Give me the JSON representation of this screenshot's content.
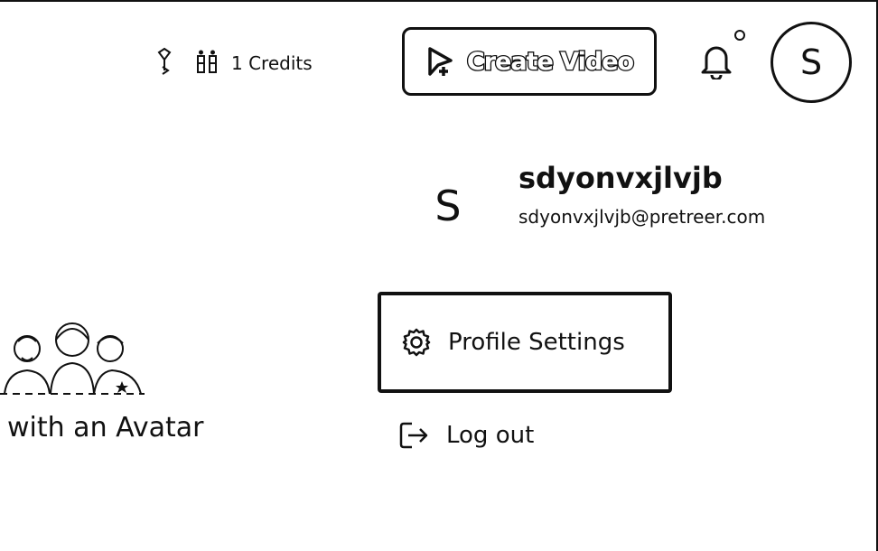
{
  "header": {
    "credits_label": "1 Credits",
    "create_video_label": "Create Video",
    "avatar_initial": "S",
    "icons": {
      "gem": "diamond-icon",
      "coins": "coin-stack-icon",
      "create": "video-plus-icon",
      "notifications": "bell-icon"
    }
  },
  "profile": {
    "initial": "S",
    "username": "sdyonvxjlvjb",
    "email": "sdyonvxjlvjb@pretreer.com"
  },
  "menu": {
    "settings_label": "Profile Settings",
    "logout_label": "Log out"
  },
  "promo": {
    "caption": "with an Avatar"
  }
}
